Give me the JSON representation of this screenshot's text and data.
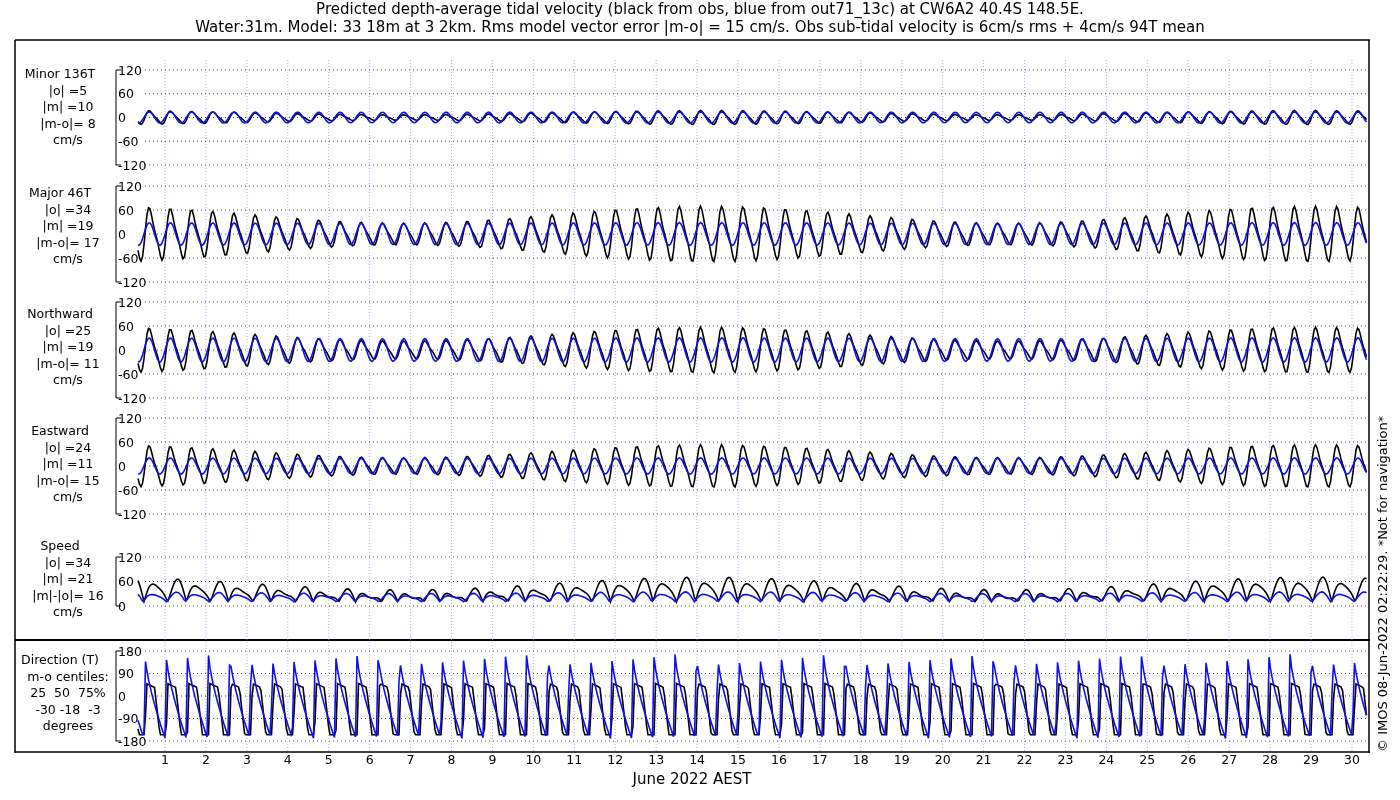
{
  "title": {
    "line_1": "Predicted depth-average tidal velocity (black from obs, blue from out71_13c) at CW6A2 40.4S 148.5E.",
    "line_2": "Water:31m. Model: 33 18m at 3 2km. Rms model vector error |m-o| = 15 cm/s. Obs sub-tidal velocity is 6cm/s rms + 4cm/s 94T mean"
  },
  "panels": [
    {
      "kind": "signed",
      "label_lines": [
        "Minor 136T",
        "|o| =5",
        "|m| =10",
        "|m-o|= 8",
        "cm/s"
      ],
      "yticks": [
        "120",
        "60",
        "0",
        "-60",
        "-120"
      ]
    },
    {
      "kind": "signed",
      "label_lines": [
        "Major 46T",
        "|o| =34",
        "|m| =19",
        "|m-o|= 17",
        "cm/s"
      ],
      "yticks": [
        "120",
        "60",
        "0",
        "-60",
        "-120"
      ]
    },
    {
      "kind": "signed",
      "label_lines": [
        "Northward",
        "|o| =25",
        "|m| =19",
        "|m-o|= 11",
        "cm/s"
      ],
      "yticks": [
        "120",
        "60",
        "0",
        "-60",
        "-120"
      ]
    },
    {
      "kind": "signed",
      "label_lines": [
        "Eastward",
        "|o| =24",
        "|m| =11",
        "|m-o|= 15",
        "cm/s"
      ],
      "yticks": [
        "120",
        "60",
        "0",
        "-60",
        "-120"
      ]
    },
    {
      "kind": "speed",
      "label_lines": [
        "Speed",
        "|o| =34",
        "|m| =21",
        "|m|-|o|= 16",
        "cm/s"
      ],
      "yticks": [
        "120",
        "60",
        "0"
      ]
    },
    {
      "kind": "direction",
      "label_lines": [
        "Direction (T)",
        "m-o centiles:",
        "25  50  75%",
        "-30 -18  -3",
        "degrees"
      ],
      "yticks": [
        "180",
        "90",
        "0",
        "-90",
        "-180"
      ]
    }
  ],
  "x_axis": {
    "ticks": [
      "1",
      "2",
      "3",
      "4",
      "5",
      "6",
      "7",
      "8",
      "9",
      "10",
      "11",
      "12",
      "13",
      "14",
      "15",
      "16",
      "17",
      "18",
      "19",
      "20",
      "21",
      "22",
      "23",
      "24",
      "25",
      "26",
      "27",
      "28",
      "29",
      "30"
    ],
    "label": "June 2022 AEST"
  },
  "credit": "© IMOS 08-Jun-2022 02:22:29. *Not for navigation*"
}
